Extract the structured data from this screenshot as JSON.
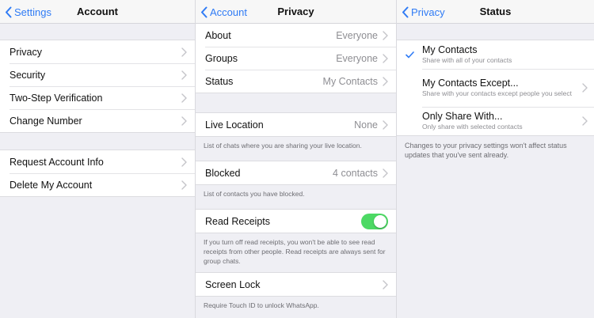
{
  "account": {
    "back_label": "Settings",
    "title": "Account",
    "group1": [
      {
        "label": "Privacy"
      },
      {
        "label": "Security"
      },
      {
        "label": "Two-Step Verification"
      },
      {
        "label": "Change Number"
      }
    ],
    "group2": [
      {
        "label": "Request Account Info"
      },
      {
        "label": "Delete My Account"
      }
    ]
  },
  "privacy": {
    "back_label": "Account",
    "title": "Privacy",
    "about": {
      "label": "About",
      "value": "Everyone"
    },
    "groups": {
      "label": "Groups",
      "value": "Everyone"
    },
    "status": {
      "label": "Status",
      "value": "My Contacts"
    },
    "live_location": {
      "label": "Live Location",
      "value": "None",
      "note": "List of chats where you are sharing your live location."
    },
    "blocked": {
      "label": "Blocked",
      "value": "4 contacts",
      "note": "List of contacts you have blocked."
    },
    "read_receipts": {
      "label": "Read Receipts",
      "enabled": true,
      "note": "If you turn off read receipts, you won't be able to see read receipts from other people. Read receipts are always sent for group chats."
    },
    "screen_lock": {
      "label": "Screen Lock",
      "note": "Require Touch ID to unlock WhatsApp."
    }
  },
  "status": {
    "back_label": "Privacy",
    "title": "Status",
    "options": [
      {
        "title": "My Contacts",
        "subtitle": "Share with all of your contacts",
        "selected": true
      },
      {
        "title": "My Contacts Except...",
        "subtitle": "Share with your contacts except people you select",
        "selected": false
      },
      {
        "title": "Only Share With...",
        "subtitle": "Only share with selected contacts",
        "selected": false
      }
    ],
    "note": "Changes to your privacy settings won't affect status updates that you've sent already."
  },
  "colors": {
    "accent": "#2f7bf5",
    "toggle_on": "#4cd964",
    "background": "#efeff4"
  }
}
